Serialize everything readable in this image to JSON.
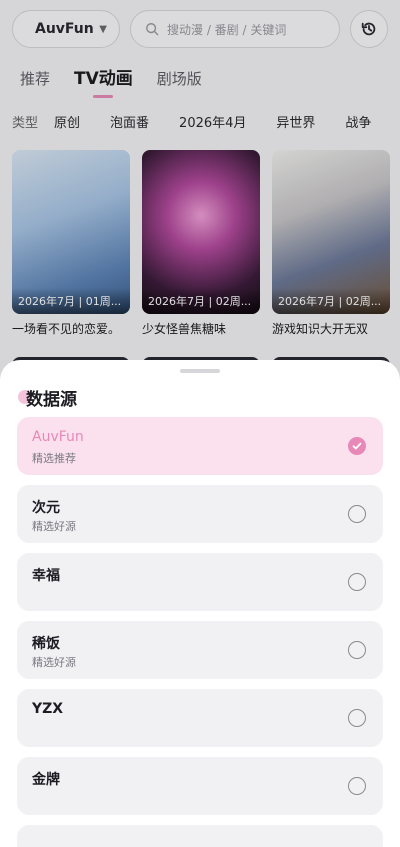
{
  "header": {
    "source_pill": "AuvFun",
    "search_placeholder": "搜动漫 / 番剧 / 关键词"
  },
  "tabs": [
    "推荐",
    "TV动画",
    "剧场版"
  ],
  "filters": {
    "label": "类型",
    "chips": [
      "原创",
      "泡面番",
      "2026年4月",
      "异世界",
      "战争"
    ]
  },
  "cards": [
    {
      "meta": "2026年7月 | 01周...",
      "title": "一场看不见的恋爱。"
    },
    {
      "meta": "2026年7月 | 02周...",
      "title": "少女怪兽焦糖味"
    },
    {
      "meta": "2026年7月 | 02周...",
      "title": "游戏知识大开无双"
    }
  ],
  "sheet": {
    "title": "数据源",
    "options": [
      {
        "name": "AuvFun",
        "desc": "精选推荐",
        "selected": true
      },
      {
        "name": "次元",
        "desc": "精选好源",
        "selected": false
      },
      {
        "name": "幸福",
        "desc": "",
        "selected": false
      },
      {
        "name": "稀饭",
        "desc": "精选好源",
        "selected": false
      },
      {
        "name": "YZX",
        "desc": "",
        "selected": false
      },
      {
        "name": "金牌",
        "desc": "",
        "selected": false
      }
    ]
  },
  "colors": {
    "accent": "#e888b7",
    "accent_bg": "#fbe1ee"
  }
}
